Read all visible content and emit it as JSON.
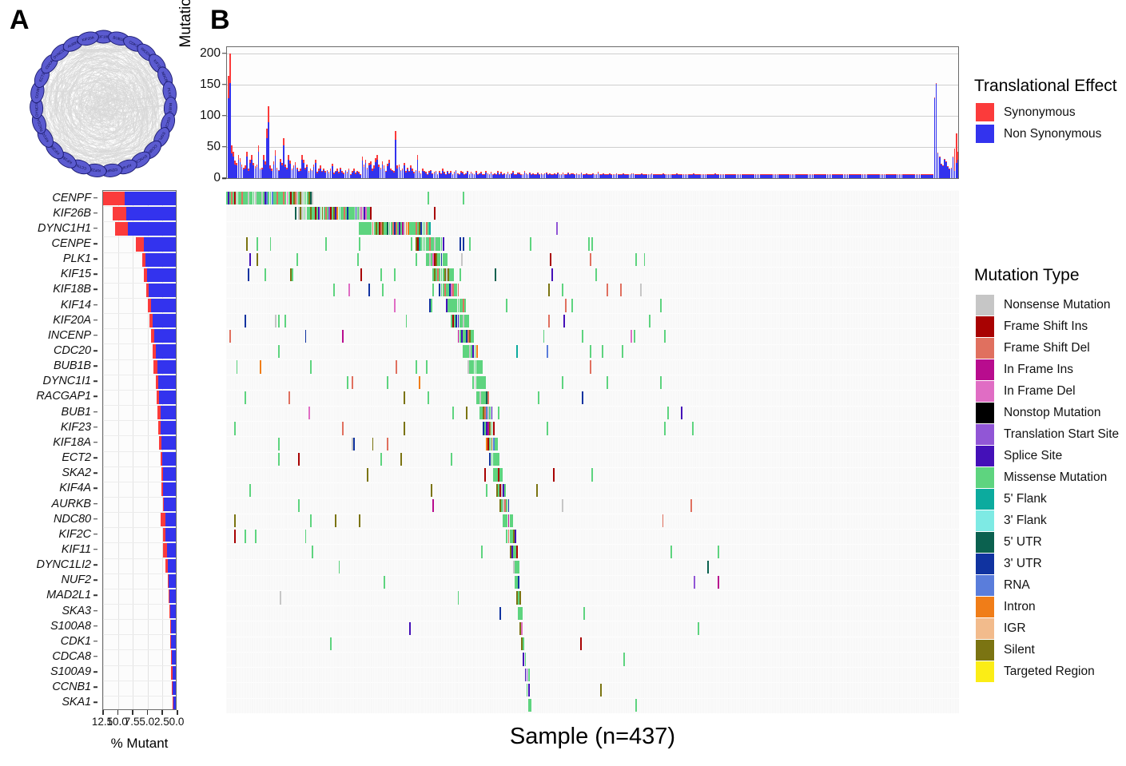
{
  "panels": {
    "a_letter": "A",
    "b_letter": "B"
  },
  "network": {
    "nodes": [
      "KIF18B",
      "BUB1B",
      "CDK1",
      "INCENP",
      "KIF11",
      "NDC80",
      "PLK1",
      "BUB1",
      "CDC20",
      "ESPL1",
      "CCNB1",
      "DYNC1I1",
      "KIF4A",
      "CENPF",
      "KIF23",
      "CCTN1",
      "KIF18A",
      "KIF26B",
      "KIF2C",
      "RACGAP1",
      "DYNC1LI2",
      "CCNB2",
      "ECT2",
      "CDCA8",
      "DYNC1H1",
      "AURKB",
      "KIF20A"
    ],
    "node_fill": "#5b5bd0",
    "node_stroke": "#1a1a6e",
    "edge_color": "#d8d8d8"
  },
  "mutation_burden": {
    "ylabel": "Mutations per MB",
    "yticks": [
      0,
      50,
      100,
      150,
      200
    ],
    "ylim": [
      0,
      210
    ],
    "colors": {
      "synonymous": "#fb3b3b",
      "non_synonymous": "#3333ee"
    }
  },
  "percent_mutant": {
    "xlabel": "% Mutant",
    "xticks": [
      "12.5",
      "10.0",
      "7.5",
      "5.0",
      "2.5",
      "0.0"
    ],
    "xlim_reversed": [
      12.5,
      0.0
    ],
    "colors": {
      "synonymous": "#fb3b3b",
      "non_synonymous": "#3333ee"
    }
  },
  "oncoplot": {
    "xlabel": "Sample (n=437)",
    "n_samples": 437
  },
  "genes": [
    {
      "name": "CENPF",
      "syn": 3.9,
      "nonsyn": 8.6
    },
    {
      "name": "KIF26B",
      "syn": 2.3,
      "nonsyn": 8.3
    },
    {
      "name": "DYNC1H1",
      "syn": 2.1,
      "nonsyn": 8.1
    },
    {
      "name": "CENPE",
      "syn": 1.3,
      "nonsyn": 5.4
    },
    {
      "name": "PLK1",
      "syn": 0.5,
      "nonsyn": 5.1
    },
    {
      "name": "KIF15",
      "syn": 0.5,
      "nonsyn": 4.9
    },
    {
      "name": "KIF18B",
      "syn": 0.4,
      "nonsyn": 4.6
    },
    {
      "name": "KIF14",
      "syn": 0.5,
      "nonsyn": 4.2
    },
    {
      "name": "KIF20A",
      "syn": 0.5,
      "nonsyn": 3.9
    },
    {
      "name": "INCENP",
      "syn": 0.6,
      "nonsyn": 3.6
    },
    {
      "name": "CDC20",
      "syn": 0.5,
      "nonsyn": 3.4
    },
    {
      "name": "BUB1B",
      "syn": 0.6,
      "nonsyn": 3.1
    },
    {
      "name": "DYNC1I1",
      "syn": 0.5,
      "nonsyn": 2.9
    },
    {
      "name": "RACGAP1",
      "syn": 0.4,
      "nonsyn": 2.8
    },
    {
      "name": "BUB1",
      "syn": 0.5,
      "nonsyn": 2.6
    },
    {
      "name": "KIF23",
      "syn": 0.4,
      "nonsyn": 2.5
    },
    {
      "name": "KIF18A",
      "syn": 0.4,
      "nonsyn": 2.4
    },
    {
      "name": "ECT2",
      "syn": 0.3,
      "nonsyn": 2.3
    },
    {
      "name": "SKA2",
      "syn": 0.2,
      "nonsyn": 2.2
    },
    {
      "name": "KIF4A",
      "syn": 0.3,
      "nonsyn": 2.1
    },
    {
      "name": "AURKB",
      "syn": 0.2,
      "nonsyn": 2.0
    },
    {
      "name": "NDC80",
      "syn": 0.8,
      "nonsyn": 1.7
    },
    {
      "name": "KIF2C",
      "syn": 0.5,
      "nonsyn": 1.7
    },
    {
      "name": "KIF11",
      "syn": 0.6,
      "nonsyn": 1.5
    },
    {
      "name": "DYNC1LI2",
      "syn": 0.4,
      "nonsyn": 1.3
    },
    {
      "name": "NUF2",
      "syn": 0.1,
      "nonsyn": 1.2
    },
    {
      "name": "MAD2L1",
      "syn": 0.1,
      "nonsyn": 1.1
    },
    {
      "name": "SKA3",
      "syn": 0.1,
      "nonsyn": 1.0
    },
    {
      "name": "S100A8",
      "syn": 0.1,
      "nonsyn": 0.9
    },
    {
      "name": "CDK1",
      "syn": 0.1,
      "nonsyn": 0.8
    },
    {
      "name": "CDCA8",
      "syn": 0.1,
      "nonsyn": 0.7
    },
    {
      "name": "S100A9",
      "syn": 0.2,
      "nonsyn": 0.6
    },
    {
      "name": "CCNB1",
      "syn": 0.2,
      "nonsyn": 0.5
    },
    {
      "name": "SKA1",
      "syn": 0.2,
      "nonsyn": 0.4
    }
  ],
  "translational_effect_legend": {
    "title": "Translational Effect",
    "items": [
      {
        "label": "Synonymous",
        "color": "#fb3b3b"
      },
      {
        "label": "Non Synonymous",
        "color": "#3333ee"
      }
    ]
  },
  "mutation_type_legend": {
    "title": "Mutation Type",
    "items": [
      {
        "label": "Nonsense Mutation",
        "color": "#c6c6c6"
      },
      {
        "label": "Frame Shift Ins",
        "color": "#a80202"
      },
      {
        "label": "Frame Shift Del",
        "color": "#e0705f"
      },
      {
        "label": "In Frame Ins",
        "color": "#b80c8e"
      },
      {
        "label": "In Frame Del",
        "color": "#e06dc4"
      },
      {
        "label": "Nonstop Mutation",
        "color": "#000000"
      },
      {
        "label": "Translation Start Site",
        "color": "#9156d6"
      },
      {
        "label": "Splice Site",
        "color": "#4410b8"
      },
      {
        "label": "Missense Mutation",
        "color": "#5ed47f"
      },
      {
        "label": "5' Flank",
        "color": "#0cab9e"
      },
      {
        "label": "3' Flank",
        "color": "#7eeae4"
      },
      {
        "label": "5' UTR",
        "color": "#0b614f"
      },
      {
        "label": "3' UTR",
        "color": "#1033a0"
      },
      {
        "label": "RNA",
        "color": "#5a7ddb"
      },
      {
        "label": "Intron",
        "color": "#f07d18"
      },
      {
        "label": "IGR",
        "color": "#f2bb8c"
      },
      {
        "label": "Silent",
        "color": "#7b7412"
      },
      {
        "label": "Targeted Region",
        "color": "#fbed16"
      }
    ]
  },
  "chart_data": [
    {
      "type": "bar",
      "name": "tumor-mutation-burden",
      "title": "",
      "xlabel": "Sample (n=437)",
      "ylabel": "Mutations per MB",
      "ylim": [
        0,
        210
      ],
      "yticks": [
        0,
        50,
        100,
        150,
        200
      ],
      "grid": true,
      "stacked": true,
      "legend": "Translational Effect",
      "series": [
        {
          "name": "Non Synonymous",
          "color": "#3333ee"
        },
        {
          "name": "Synonymous",
          "color": "#fb3b3b"
        }
      ],
      "values_non_synonymous": [
        128,
        152,
        40,
        34,
        22,
        20,
        30,
        26,
        18,
        14,
        16,
        34,
        12,
        24,
        30,
        20,
        15,
        18,
        42,
        13,
        14,
        30,
        22,
        64,
        90,
        16,
        12,
        22,
        36,
        14,
        11,
        25,
        20,
        52,
        18,
        14,
        30,
        23,
        13,
        17,
        21,
        14,
        10,
        12,
        30,
        24,
        14,
        18,
        9,
        13,
        11,
        18,
        24,
        8,
        12,
        16,
        10,
        13,
        9,
        11,
        8,
        12,
        19,
        7,
        10,
        12,
        8,
        14,
        9,
        7,
        11,
        8,
        13,
        6,
        9,
        12,
        7,
        10,
        8,
        6,
        28,
        18,
        24,
        14,
        20,
        22,
        12,
        16,
        26,
        30,
        18,
        14,
        22,
        16,
        10,
        19,
        24,
        13,
        11,
        9,
        62,
        16,
        18,
        11,
        13,
        20,
        9,
        14,
        10,
        17,
        12,
        8,
        11,
        30,
        9,
        7,
        12,
        10,
        8,
        6,
        9,
        11,
        7,
        8,
        10,
        6,
        9,
        7,
        12,
        8,
        6,
        10,
        7,
        9,
        6,
        8,
        11,
        7,
        6,
        9,
        8,
        5,
        7,
        10,
        6,
        8,
        7,
        5,
        9,
        6,
        7,
        8,
        5,
        6,
        9,
        7,
        5,
        8,
        6,
        7,
        5,
        9,
        6,
        8,
        5,
        7,
        6,
        8,
        5,
        7,
        9,
        6,
        5,
        8,
        7,
        6,
        5,
        9,
        7,
        6,
        8,
        5,
        7,
        6,
        5,
        8,
        6,
        7,
        5,
        6,
        8,
        5,
        7,
        6,
        5,
        7,
        6,
        8,
        5,
        6,
        7,
        5,
        6,
        8,
        5,
        7,
        6,
        5,
        7,
        6,
        5,
        8,
        6,
        5,
        7,
        6,
        5,
        6,
        7,
        5,
        6,
        8,
        5,
        6,
        7,
        5,
        6,
        5,
        7,
        6,
        5,
        6,
        7,
        5,
        6,
        5,
        7,
        6,
        5,
        6,
        5,
        7,
        6,
        5,
        6,
        5,
        6,
        7,
        5,
        6,
        5,
        6,
        5,
        7,
        6,
        5,
        6,
        5,
        6,
        5,
        7,
        6,
        5,
        6,
        5,
        6,
        5,
        6,
        7,
        5,
        6,
        5,
        6,
        5,
        6,
        5,
        6,
        5,
        7,
        6,
        5,
        6,
        5,
        6,
        5,
        6,
        5,
        6,
        5,
        6,
        5,
        7,
        6,
        5,
        6,
        5,
        6,
        5,
        6,
        5,
        6,
        5,
        6,
        5,
        6,
        5,
        6,
        5,
        6,
        5,
        6,
        5,
        6,
        5,
        6,
        5,
        6,
        5,
        6,
        5,
        6,
        5,
        6,
        5,
        6,
        5,
        6,
        5,
        6,
        5,
        6,
        5,
        6,
        5,
        6,
        5,
        6,
        5,
        6,
        5,
        6,
        5,
        6,
        5,
        6,
        5,
        6,
        5,
        6,
        5,
        6,
        5,
        6,
        5,
        6,
        5,
        6,
        5,
        6,
        5,
        6,
        5,
        6,
        5,
        6,
        5,
        6,
        5,
        6,
        5,
        6,
        5,
        6,
        5,
        6,
        5,
        6,
        5,
        6,
        5,
        6,
        5,
        6,
        5,
        6,
        5,
        6,
        5,
        6,
        5,
        6,
        5,
        6,
        5,
        6,
        5,
        6,
        5,
        6,
        5,
        6,
        5,
        6,
        5,
        6,
        5,
        6,
        5,
        6,
        5,
        6,
        5,
        6,
        5,
        6,
        5,
        6,
        5,
        6,
        5,
        6,
        5
      ],
      "values_synonymous": [
        36,
        48,
        12,
        8,
        6,
        5,
        7,
        6,
        4,
        3,
        4,
        8,
        3,
        6,
        7,
        5,
        4,
        4,
        10,
        3,
        3,
        7,
        5,
        15,
        25,
        4,
        3,
        5,
        9,
        3,
        2,
        6,
        5,
        12,
        4,
        3,
        7,
        5,
        3,
        4,
        5,
        3,
        2,
        3,
        7,
        6,
        3,
        4,
        2,
        3,
        2,
        4,
        6,
        2,
        3,
        4,
        2,
        3,
        2,
        2,
        2,
        3,
        4,
        2,
        2,
        3,
        2,
        3,
        2,
        2,
        2,
        2,
        3,
        1,
        2,
        3,
        2,
        2,
        2,
        1,
        7,
        4,
        6,
        3,
        5,
        5,
        3,
        4,
        6,
        7,
        4,
        3,
        5,
        4,
        2,
        4,
        6,
        3,
        2,
        2,
        14,
        4,
        4,
        2,
        3,
        5,
        2,
        3,
        2,
        4,
        3,
        2,
        2,
        7,
        2,
        1,
        3,
        2,
        2,
        1,
        2,
        2,
        1,
        2,
        2,
        1,
        2,
        1,
        3,
        2,
        1,
        2,
        1,
        2,
        1,
        2,
        2,
        1,
        1,
        2,
        2,
        1,
        1,
        2,
        1,
        2,
        1,
        1,
        2,
        1,
        1,
        2,
        1,
        1,
        2,
        1,
        1,
        2,
        1,
        1,
        1,
        2,
        1,
        2,
        1,
        1,
        1,
        2,
        1,
        1,
        2,
        1,
        1,
        1,
        2,
        1,
        1,
        2,
        1,
        1,
        1,
        2,
        1,
        1,
        2,
        1,
        1,
        1,
        1,
        2,
        1,
        1,
        1,
        1,
        2,
        1,
        1,
        1,
        1,
        1,
        2,
        1,
        1,
        1,
        1,
        1,
        2,
        1,
        1,
        1,
        1,
        1,
        1,
        2,
        1,
        1,
        1,
        1,
        1,
        1,
        1,
        2,
        1,
        1,
        1,
        1,
        1,
        1,
        1,
        1,
        2,
        1,
        1,
        1,
        1,
        1,
        1,
        1,
        1,
        1,
        1,
        1,
        2,
        1,
        1,
        1,
        1,
        1,
        1,
        1,
        1,
        1,
        1,
        1,
        1,
        1,
        1,
        1,
        1,
        1,
        1,
        1,
        1,
        1,
        1,
        1,
        1,
        1,
        1,
        1,
        1,
        1,
        1,
        1,
        1,
        1,
        1,
        1,
        1,
        1,
        1,
        1,
        1,
        1,
        1,
        1,
        1,
        1,
        1,
        1,
        1,
        1,
        1,
        1,
        1,
        1,
        1,
        1,
        1,
        1,
        1,
        1,
        1,
        1,
        1,
        1,
        1,
        1,
        1,
        1,
        1,
        1,
        1,
        1,
        1,
        1,
        1,
        1,
        1,
        1,
        1,
        1,
        1,
        1,
        1,
        1,
        1,
        1,
        1,
        1,
        1,
        1,
        1,
        1,
        1,
        1,
        1,
        1,
        1,
        1,
        1,
        1,
        1,
        1,
        1,
        1,
        1,
        1,
        1,
        1,
        1,
        1,
        1,
        1,
        1,
        1,
        1,
        1,
        1,
        1,
        1,
        1,
        1,
        1,
        1,
        1,
        1,
        1,
        1,
        1,
        1,
        1,
        1,
        1,
        1,
        1,
        1,
        1,
        1,
        1,
        1,
        1,
        1,
        1,
        1,
        1,
        1,
        1,
        1,
        1,
        1,
        1,
        1,
        1,
        1,
        1,
        1,
        1,
        1,
        1,
        1,
        1,
        1,
        1,
        1,
        1,
        1,
        1,
        1,
        1,
        1,
        1,
        1,
        1,
        1,
        1,
        1,
        1,
        1,
        1,
        1,
        1,
        1,
        1,
        1,
        1,
        1,
        1,
        1,
        1,
        1,
        1,
        1,
        1
      ]
    },
    {
      "type": "bar",
      "name": "percent-mutant-per-gene",
      "orientation": "horizontal",
      "xlabel": "% Mutant",
      "ylabel": "",
      "xlim": [
        12.5,
        0.0
      ],
      "xticks": [
        12.5,
        10.0,
        7.5,
        5.0,
        2.5,
        0.0
      ],
      "axis_reversed": true,
      "stacked": true,
      "categories": [
        "CENPF",
        "KIF26B",
        "DYNC1H1",
        "CENPE",
        "PLK1",
        "KIF15",
        "KIF18B",
        "KIF14",
        "KIF20A",
        "INCENP",
        "CDC20",
        "BUB1B",
        "DYNC1I1",
        "RACGAP1",
        "BUB1",
        "KIF23",
        "KIF18A",
        "ECT2",
        "SKA2",
        "KIF4A",
        "AURKB",
        "NDC80",
        "KIF2C",
        "KIF11",
        "DYNC1LI2",
        "NUF2",
        "MAD2L1",
        "SKA3",
        "S100A8",
        "CDK1",
        "CDCA8",
        "S100A9",
        "CCNB1",
        "SKA1"
      ],
      "series": [
        {
          "name": "Synonymous",
          "color": "#fb3b3b",
          "values": [
            3.9,
            2.3,
            2.1,
            1.3,
            0.5,
            0.5,
            0.4,
            0.5,
            0.5,
            0.6,
            0.5,
            0.6,
            0.5,
            0.4,
            0.5,
            0.4,
            0.4,
            0.3,
            0.2,
            0.3,
            0.2,
            0.8,
            0.5,
            0.6,
            0.4,
            0.1,
            0.1,
            0.1,
            0.1,
            0.1,
            0.1,
            0.2,
            0.2,
            0.2
          ]
        },
        {
          "name": "Non Synonymous",
          "color": "#3333ee",
          "values": [
            8.6,
            8.3,
            8.1,
            5.4,
            5.1,
            4.9,
            4.6,
            4.2,
            3.9,
            3.6,
            3.4,
            3.1,
            2.9,
            2.8,
            2.6,
            2.5,
            2.4,
            2.3,
            2.2,
            2.1,
            2.0,
            1.7,
            1.7,
            1.5,
            1.3,
            1.2,
            1.1,
            1.0,
            0.9,
            0.8,
            0.7,
            0.6,
            0.5,
            0.4
          ]
        }
      ]
    },
    {
      "type": "heatmap",
      "name": "oncoplot-waterfall",
      "xlabel": "Sample (n=437)",
      "n_samples": 437,
      "genes": [
        "CENPF",
        "KIF26B",
        "DYNC1H1",
        "CENPE",
        "PLK1",
        "KIF15",
        "KIF18B",
        "KIF14",
        "KIF20A",
        "INCENP",
        "CDC20",
        "BUB1B",
        "DYNC1I1",
        "RACGAP1",
        "BUB1",
        "KIF23",
        "KIF18A",
        "ECT2",
        "SKA2",
        "KIF4A",
        "AURKB",
        "NDC80",
        "KIF2C",
        "KIF11",
        "DYNC1LI2",
        "NUF2",
        "MAD2L1",
        "SKA3",
        "S100A8",
        "CDK1",
        "CDCA8",
        "S100A9",
        "CCNB1",
        "SKA1"
      ],
      "legend": "Mutation Type",
      "background": "#f7f7f7"
    }
  ]
}
